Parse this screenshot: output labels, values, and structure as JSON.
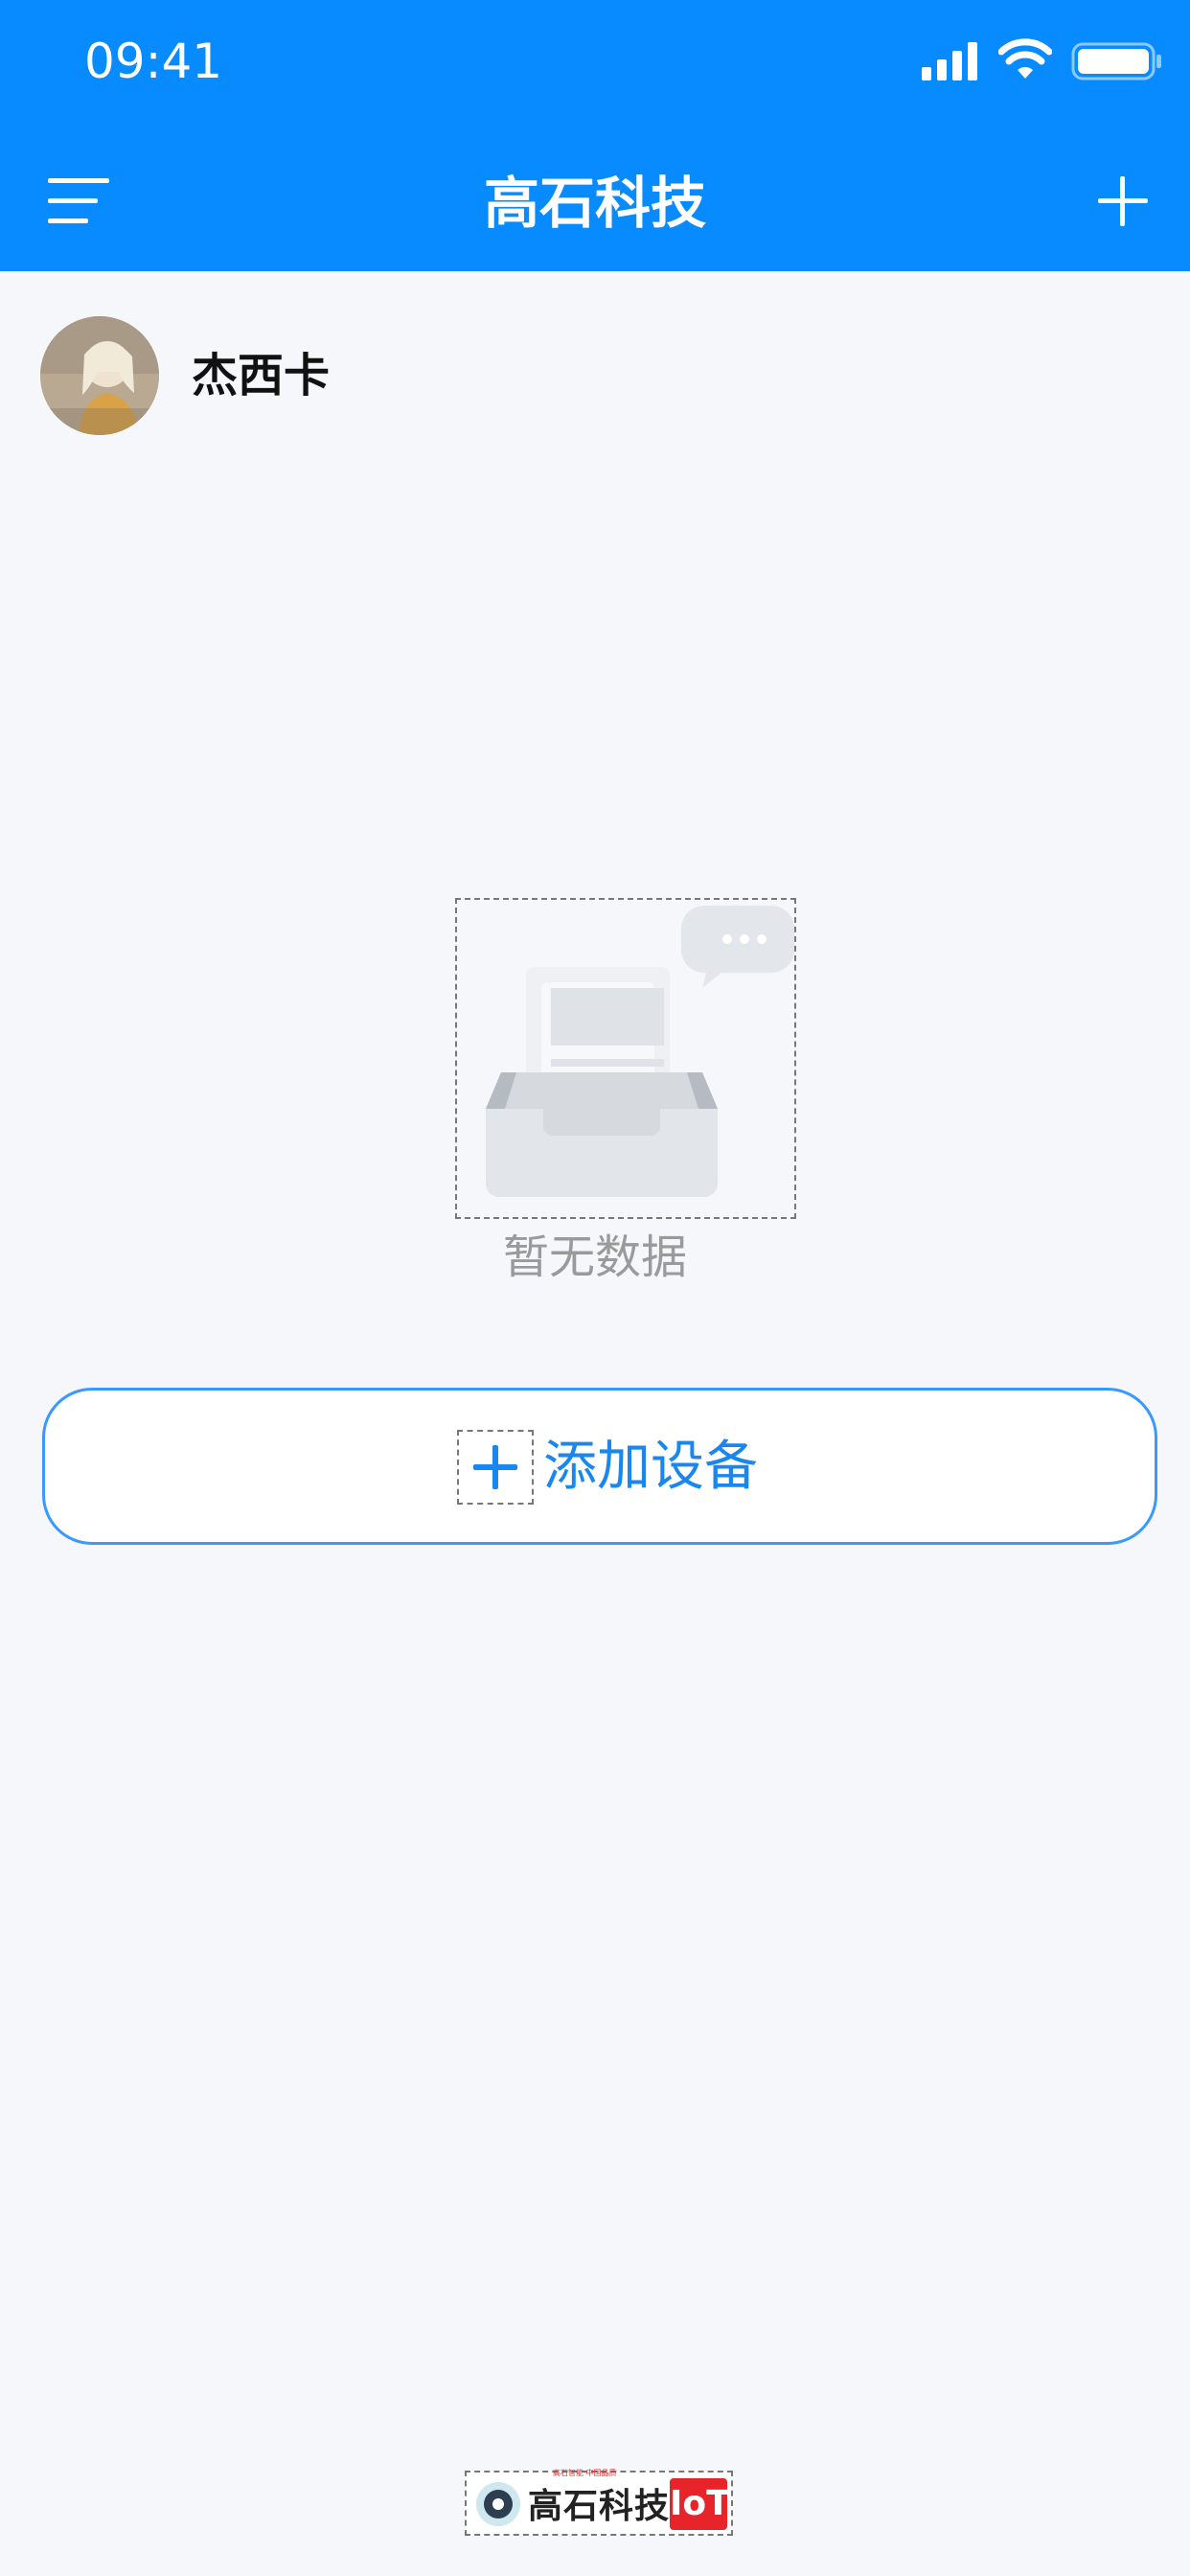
{
  "status_bar": {
    "time": "09:41"
  },
  "header": {
    "title": "高石科技",
    "menu_icon": "menu-lines-icon",
    "add_icon": "plus-icon",
    "background_color": "#078bff"
  },
  "user": {
    "name": "杰西卡",
    "avatar_icon": "user-avatar-photo"
  },
  "empty_state": {
    "text": "暂无数据",
    "illustration": "empty-inbox-illustration"
  },
  "add_device": {
    "label": "添加设备",
    "icon": "plus-icon",
    "accent_color": "#1a86f0"
  },
  "footer": {
    "logo_text": "高石科技",
    "logo_badge": "IoT",
    "logo_tag": "高石智能·中国品质"
  }
}
